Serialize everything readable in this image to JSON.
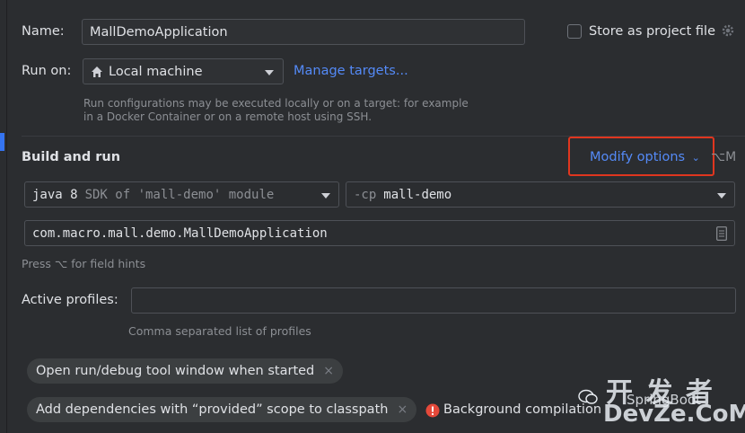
{
  "name_label": "Name:",
  "name_value": "MallDemoApplication",
  "store_label": "Store as project file",
  "run_on_label": "Run on:",
  "run_on_value": "Local machine",
  "manage_targets": "Manage targets...",
  "run_hint_1": "Run configurations may be executed locally or on a target: for example",
  "run_hint_2": "in a Docker Container or on a remote host using SSH.",
  "build_run_title": "Build and run",
  "modify_options": "Modify options",
  "modify_shortcut": "⌥M",
  "sdk_java": "java 8",
  "sdk_desc": "SDK of 'mall-demo' module",
  "cp_prefix": "-cp",
  "cp_value": "mall-demo",
  "main_class": "com.macro.mall.demo.MallDemoApplication",
  "field_hint": "Press ⌥ for field hints",
  "profiles_label": "Active profiles:",
  "profiles_value": "",
  "profiles_hint": "Comma separated list of profiles",
  "chip_1": "Open run/debug tool window when started",
  "chip_2": "Add dependencies with “provided” scope to classpath",
  "bg_compile": "Background compilation",
  "chip_close": "×",
  "watermark_cn": "开 发 者",
  "watermark_springboot": "SpringBoot",
  "watermark_site": "DevZe.CoM",
  "colors": {
    "accent": "#548af7",
    "error": "#e5493a",
    "highlight_box": "#e0361f"
  }
}
